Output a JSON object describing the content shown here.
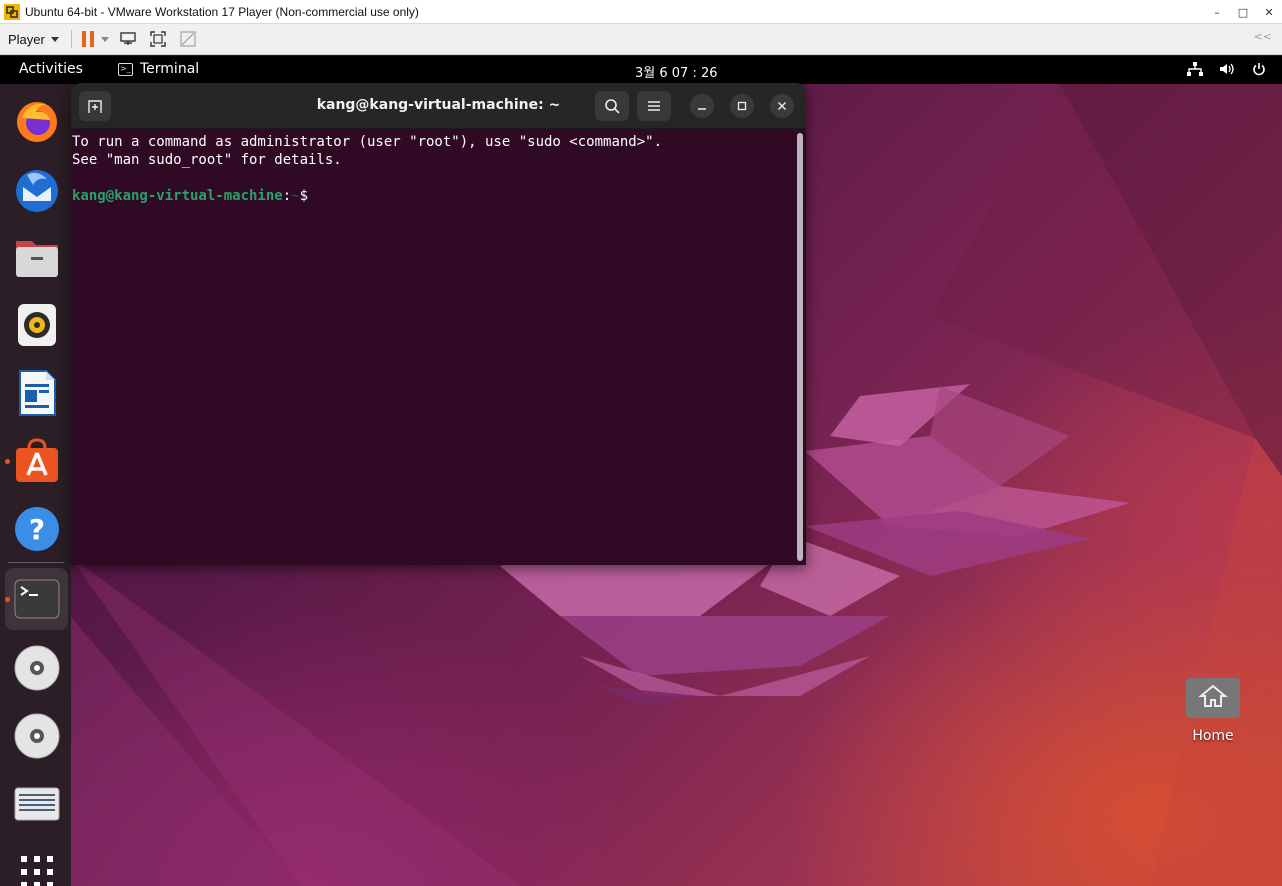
{
  "vmware": {
    "window_title": "Ubuntu 64-bit - VMware Workstation 17 Player (Non-commercial use only)",
    "player_menu_label": "Player",
    "window_buttons": [
      "–",
      "□",
      "✕"
    ]
  },
  "topbar": {
    "activities_label": "Activities",
    "app_menu_label": "Terminal",
    "clock": "3월 6  07 : 26"
  },
  "dock": {
    "items": [
      {
        "name": "Firefox",
        "icon": "firefox-icon"
      },
      {
        "name": "Thunderbird",
        "icon": "thunderbird-icon"
      },
      {
        "name": "Files",
        "icon": "files-icon"
      },
      {
        "name": "Rhythmbox",
        "icon": "rhythmbox-icon"
      },
      {
        "name": "LibreOffice Writer",
        "icon": "writer-icon"
      },
      {
        "name": "Ubuntu Software",
        "icon": "software-icon"
      },
      {
        "name": "Help",
        "icon": "help-icon"
      },
      {
        "name": "Terminal",
        "icon": "terminal-icon"
      },
      {
        "name": "Disc 1",
        "icon": "disc-icon"
      },
      {
        "name": "Disc 2",
        "icon": "disc-icon"
      },
      {
        "name": "Drive",
        "icon": "drive-icon"
      },
      {
        "name": "Show Applications",
        "icon": "app-grid-icon"
      }
    ]
  },
  "terminal": {
    "title": "kang@kang-virtual-machine: ~",
    "line1": "To run a command as administrator (user \"root\"), use \"sudo <command>\".",
    "line2": "See \"man sudo_root\" for details.",
    "prompt_user": "kang@kang-virtual-machine",
    "prompt_sep": ":",
    "prompt_path": "~",
    "prompt_symbol": "$ "
  },
  "desktop": {
    "home_label": "Home"
  },
  "colors": {
    "ubuntu_orange": "#e95420",
    "terminal_bg": "#300a24",
    "prompt_green": "#26a269",
    "prompt_blue": "#12488b"
  }
}
